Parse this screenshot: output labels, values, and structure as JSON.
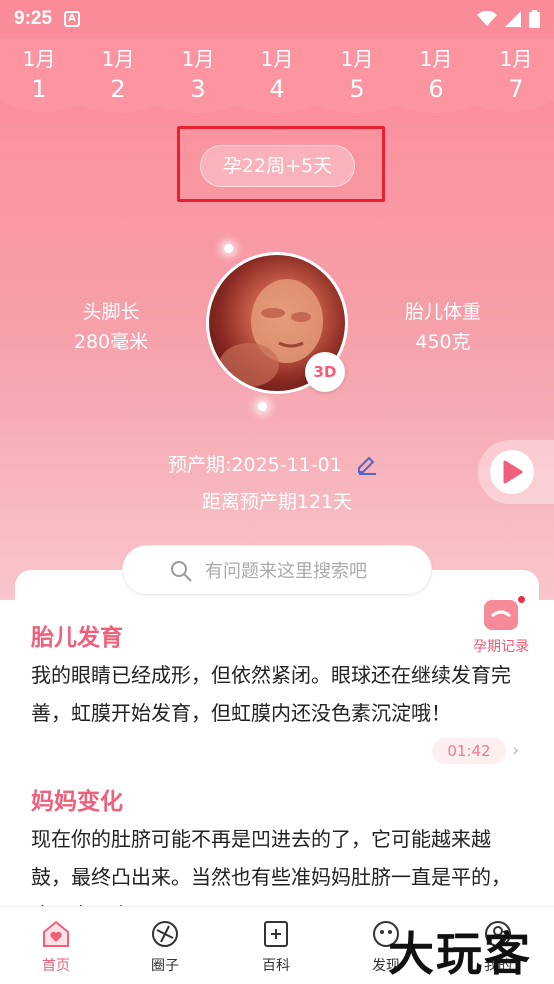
{
  "status_bar": {
    "time": "9:25",
    "app_badge": "A"
  },
  "day_strip": [
    {
      "month": "1月",
      "day": "1"
    },
    {
      "month": "1月",
      "day": "2"
    },
    {
      "month": "1月",
      "day": "3"
    },
    {
      "month": "1月",
      "day": "4"
    },
    {
      "month": "1月",
      "day": "5"
    },
    {
      "month": "1月",
      "day": "6"
    },
    {
      "month": "1月",
      "day": "7"
    }
  ],
  "week_label": "孕22周+5天",
  "stats": {
    "length_label": "头脚长",
    "length_value": "280毫米",
    "weight_label": "胎儿体重",
    "weight_value": "450克"
  },
  "badge_3d": "3D",
  "due_date": "预产期:2025-11-01",
  "countdown": "距离预产期121天",
  "search": {
    "placeholder": "有问题来这里搜索吧"
  },
  "record_label": "孕期记录",
  "sections": {
    "fetal_title": "胎儿发育",
    "fetal_text": "我的眼睛已经成形，但依然紧闭。眼球还在继续发育完善，虹膜开始发育，但虹膜内还没色素沉淀哦！",
    "audio_time": "01:42",
    "mom_title": "妈妈变化",
    "mom_text": "现在你的肚脐可能不再是凹进去的了，它可能越来越鼓，最终凸出来。当然也有些准妈妈肚脐一直是平的，这一点因人而异。"
  },
  "tabs": [
    {
      "label": "首页",
      "icon": "home-heart-icon"
    },
    {
      "label": "圈子",
      "icon": "circle-icon"
    },
    {
      "label": "百科",
      "icon": "book-icon"
    },
    {
      "label": "发现",
      "icon": "discover-icon"
    },
    {
      "label": "我的",
      "icon": "profile-icon"
    }
  ],
  "watermark": "大玩客",
  "colors": {
    "accent": "#f0607a",
    "header": "#fb8a98",
    "highlight_box": "#e8202f"
  }
}
